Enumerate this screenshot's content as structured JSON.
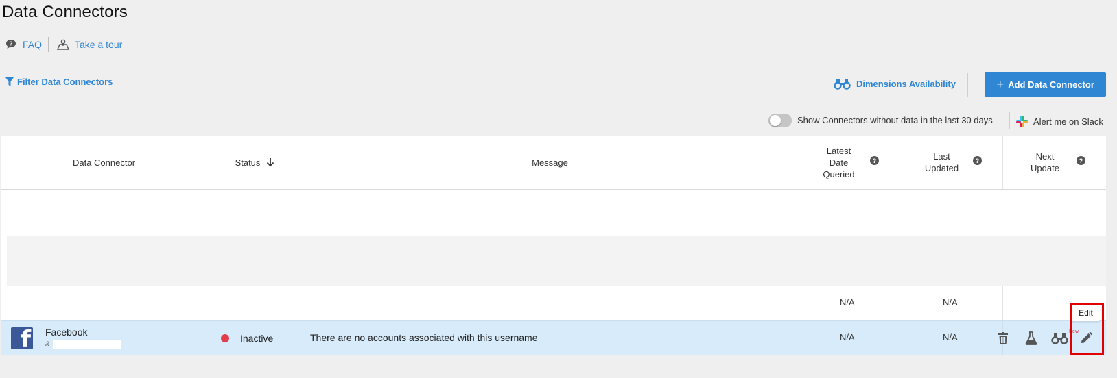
{
  "page": {
    "title": "Data Connectors"
  },
  "toplinks": {
    "faq": "FAQ",
    "tour": "Take a tour"
  },
  "toolbar": {
    "filter": "Filter Data Connectors",
    "dimensions": "Dimensions Availability",
    "add_button": "Add Data Connector",
    "toggle_label": "Show Connectors without data in the last 30 days",
    "toggle_on": false,
    "slack": "Alert me on Slack"
  },
  "table": {
    "columns": {
      "connector": "Data Connector",
      "status": "Status",
      "message": "Message",
      "latest": "Latest Date Queried",
      "latest_l1": "Latest",
      "latest_l2": "Date",
      "latest_l3": "Queried",
      "updated_l1": "Last",
      "updated_l2": "Updated",
      "next_l1": "Next",
      "next_l2": "Update"
    },
    "partial_row": {
      "latest": "N/A",
      "updated": "N/A"
    },
    "rows": [
      {
        "name": "Facebook",
        "user_prefix": "&",
        "status": "Inactive",
        "message": "There are no accounts associated with this username",
        "latest": "N/A",
        "updated": "N/A",
        "badge": "New"
      }
    ]
  },
  "tooltip": {
    "edit": "Edit"
  },
  "colors": {
    "accent": "#2f86d3",
    "inactive": "#e23d4c",
    "row_highlight": "#d7ebfa",
    "facebook": "#3b5998"
  },
  "icons": [
    "question-circle-icon",
    "map-tour-icon",
    "filter-icon",
    "binoculars-icon",
    "plus-icon",
    "slack-icon",
    "sort-down-icon",
    "facebook-icon",
    "trash-icon",
    "flask-icon",
    "binoculars-icon",
    "pencil-icon"
  ]
}
